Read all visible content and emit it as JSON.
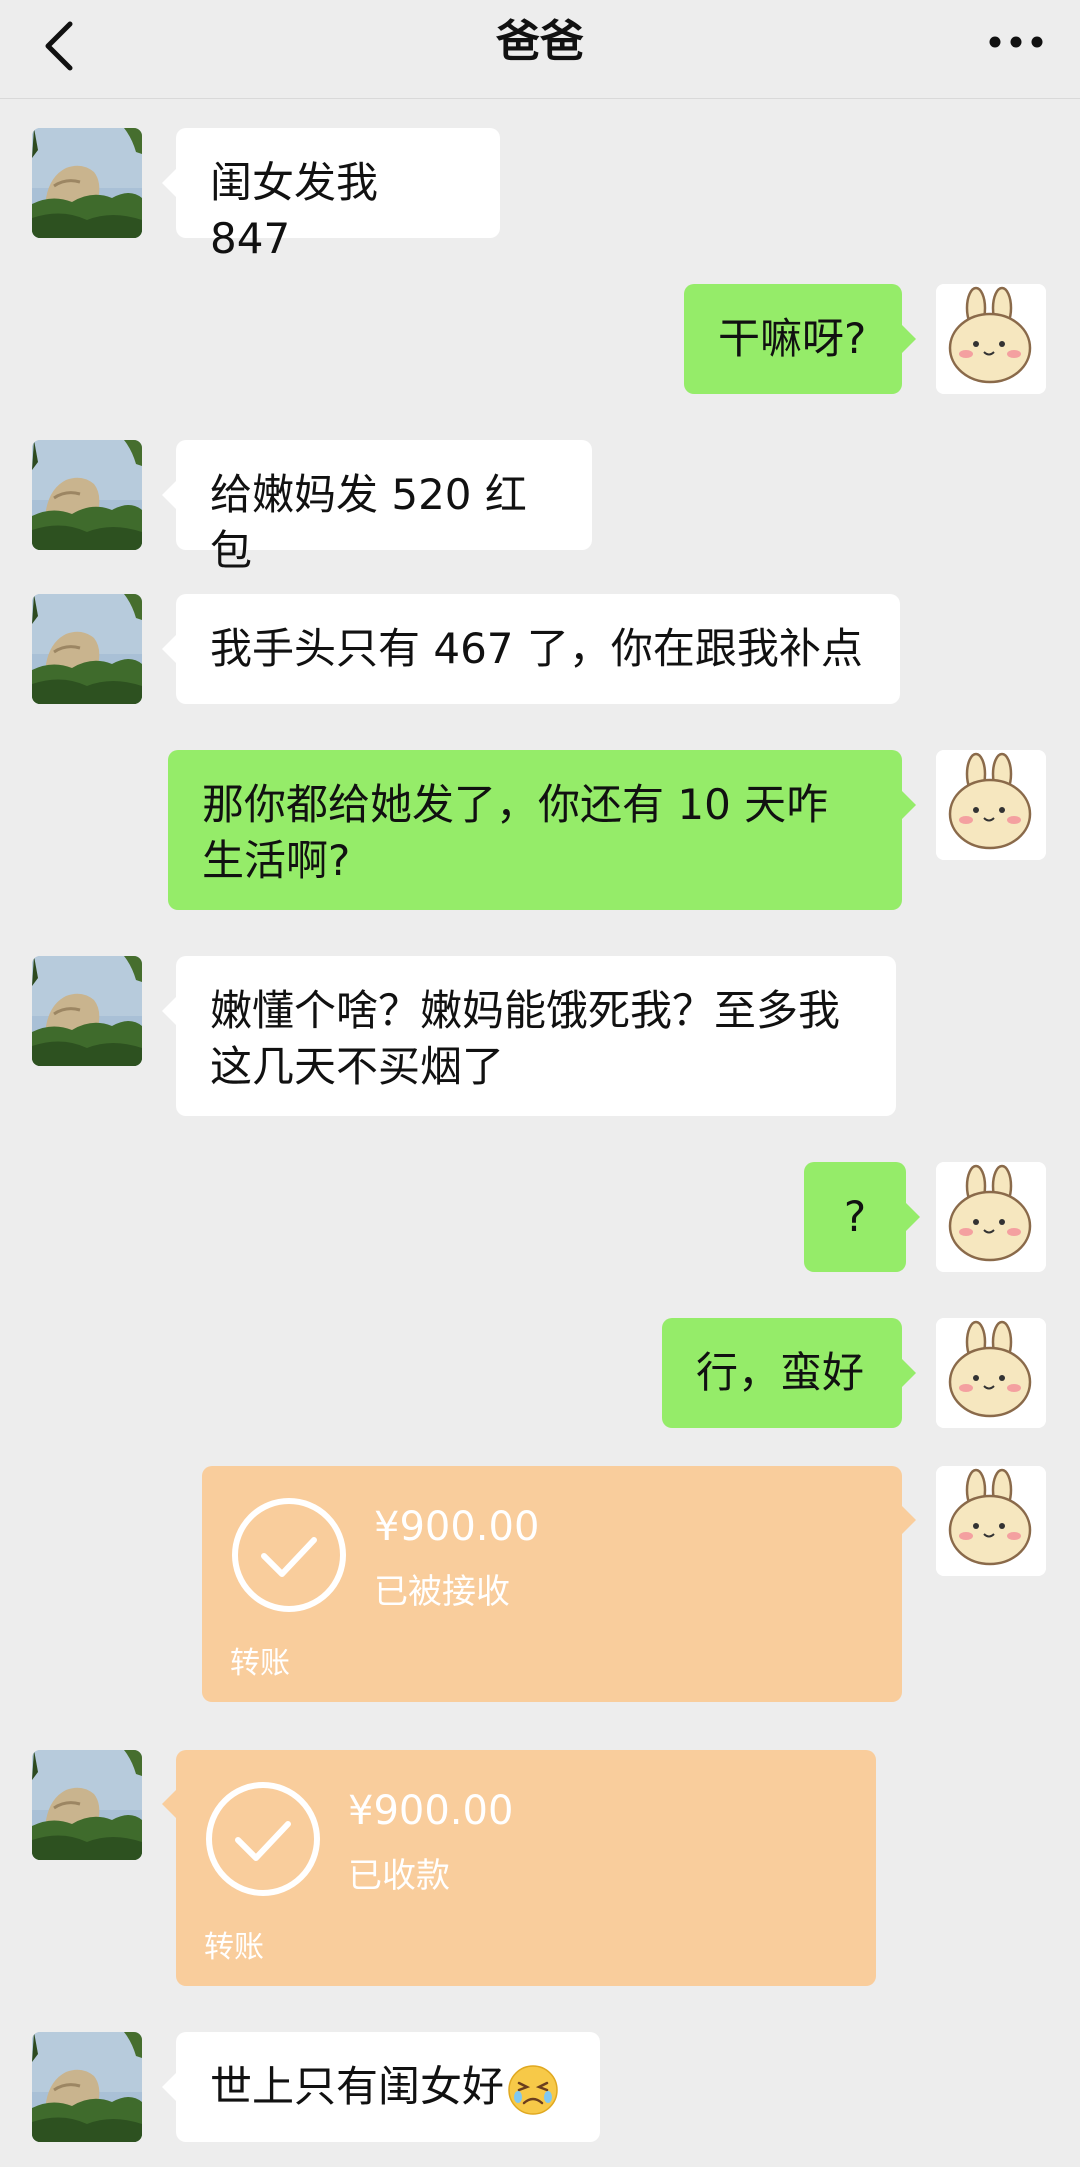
{
  "header": {
    "title": "爸爸",
    "back_icon": "chevron-left-icon",
    "more_icon": "more-dots-icon"
  },
  "colors": {
    "background": "#ededed",
    "my_bubble": "#95ec69",
    "their_bubble": "#ffffff",
    "transfer_card": "#f9cd9c"
  },
  "messages": [
    {
      "side": "left",
      "text": "闺女发我 847"
    },
    {
      "side": "right",
      "text": "干嘛呀?"
    },
    {
      "side": "left",
      "text": "给嫩妈发 520 红包"
    },
    {
      "side": "left",
      "text": "我手头只有 467 了，你在跟我补点"
    },
    {
      "side": "right",
      "text": "那你都给她发了，你还有 10 天咋生活啊?"
    },
    {
      "side": "left",
      "text": "嫩懂个啥？嫩妈能饿死我？至多我这几天不买烟了"
    },
    {
      "side": "right",
      "text": "?"
    },
    {
      "side": "right",
      "text": "行，蛮好"
    },
    {
      "side": "right",
      "type": "transfer",
      "amount": "¥900.00",
      "status": "已被接收",
      "label": "转账"
    },
    {
      "side": "left",
      "type": "transfer",
      "amount": "¥900.00",
      "status": "已收款",
      "label": "转账"
    },
    {
      "side": "left",
      "text": "世上只有闺女好",
      "emoji": "persevering-face-emoji"
    }
  ]
}
